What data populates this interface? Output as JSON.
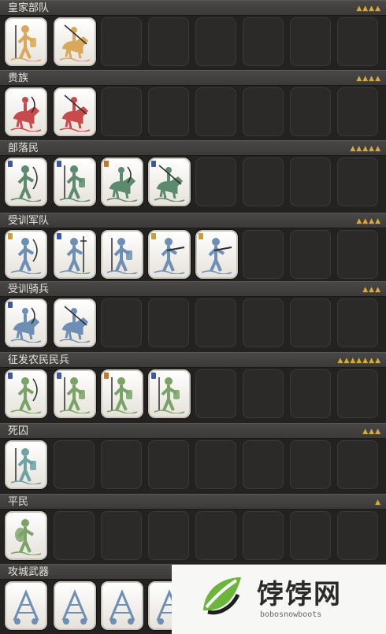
{
  "sections": [
    {
      "id": "royal",
      "title": "皇家部队",
      "pips": "▲▲▲▲",
      "units": [
        {
          "name": "royal-spear-infantry-card",
          "color": "#d9a85a",
          "tier": "",
          "kind": "foot-spear"
        },
        {
          "name": "royal-cavalry-card",
          "color": "#d9a85a",
          "tier": "",
          "kind": "horse-lance"
        }
      ]
    },
    {
      "id": "noble",
      "title": "贵族",
      "pips": "▲▲▲▲",
      "units": [
        {
          "name": "noble-horse-archer-card",
          "color": "#c94a4a",
          "tier": "",
          "kind": "horse-bow"
        },
        {
          "name": "noble-cavalry-card",
          "color": "#c94a4a",
          "tier": "",
          "kind": "horse-lance"
        }
      ]
    },
    {
      "id": "tribal",
      "title": "部落民",
      "pips": "▲▲▲▲▲",
      "units": [
        {
          "name": "tribal-archer-card",
          "color": "#5d8a6f",
          "tier": "#3a5aa0",
          "kind": "foot-bow"
        },
        {
          "name": "tribal-spearman-card",
          "color": "#5d8a6f",
          "tier": "#3a5aa0",
          "kind": "foot-spear"
        },
        {
          "name": "tribal-horse-archer-card",
          "color": "#5d8a6f",
          "tier": "#c07a2a",
          "kind": "horse-bow"
        },
        {
          "name": "tribal-cavalry-card",
          "color": "#5d8a6f",
          "tier": "#3a5aa0",
          "kind": "horse-lance"
        }
      ]
    },
    {
      "id": "trained",
      "title": "受训军队",
      "pips": "▲▲▲▲",
      "units": [
        {
          "name": "trained-archer-card",
          "color": "#6d8fb5",
          "tier": "#c9a038",
          "kind": "foot-bow"
        },
        {
          "name": "trained-pikeman-card",
          "color": "#6d8fb5",
          "tier": "#3a5aa0",
          "kind": "foot-pike"
        },
        {
          "name": "trained-swordsman-card",
          "color": "#6d8fb5",
          "tier": "",
          "kind": "foot-spear"
        },
        {
          "name": "trained-handgunner-card",
          "color": "#6d8fb5",
          "tier": "#c9a038",
          "kind": "foot-gun"
        },
        {
          "name": "trained-heavy-gunner-card",
          "color": "#6d8fb5",
          "tier": "#c9a038",
          "kind": "foot-gun"
        }
      ]
    },
    {
      "id": "trained-cav",
      "title": "受训骑兵",
      "pips": "▲▲▲",
      "units": [
        {
          "name": "trained-horse-archer-card",
          "color": "#6d8fb5",
          "tier": "#3a5aa0",
          "kind": "horse-bow"
        },
        {
          "name": "trained-cavalry-card",
          "color": "#6d8fb5",
          "tier": "",
          "kind": "horse-lance"
        }
      ]
    },
    {
      "id": "levy",
      "title": "征发农民民兵",
      "pips": "▲▲▲▲▲▲▲",
      "units": [
        {
          "name": "levy-archer-card",
          "color": "#7aa368",
          "tier": "#3a5aa0",
          "kind": "foot-bow"
        },
        {
          "name": "levy-spearman-card",
          "color": "#7aa368",
          "tier": "#3a5aa0",
          "kind": "foot-spear"
        },
        {
          "name": "levy-axeman-card",
          "color": "#7aa368",
          "tier": "#c07a2a",
          "kind": "foot-spear"
        },
        {
          "name": "levy-shield-card",
          "color": "#7aa368",
          "tier": "#3a5aa0",
          "kind": "foot-spear"
        }
      ]
    },
    {
      "id": "prisoners",
      "title": "死囚",
      "pips": "▲▲▲",
      "units": [
        {
          "name": "prisoner-card",
          "color": "#6fa3a3",
          "tier": "",
          "kind": "foot-spear"
        }
      ]
    },
    {
      "id": "civilians",
      "title": "平民",
      "pips": "▲",
      "units": [
        {
          "name": "civilian-card",
          "color": "#7aa368",
          "tier": "",
          "kind": "foot-carry"
        }
      ]
    },
    {
      "id": "siege",
      "title": "攻城武器",
      "pips": "",
      "units": [
        {
          "name": "siege-trebuchet-card",
          "color": "#6d8fb5",
          "tier": "",
          "kind": "siege"
        },
        {
          "name": "siege-catapult-card",
          "color": "#6d8fb5",
          "tier": "",
          "kind": "siege"
        },
        {
          "name": "siege-tower-card",
          "color": "#6d8fb5",
          "tier": "",
          "kind": "siege"
        },
        {
          "name": "siege-ram-card",
          "color": "#6d8fb5",
          "tier": "",
          "kind": "siege"
        }
      ]
    }
  ],
  "logo": {
    "text": "饽饽网",
    "sub": "bobosnowboots"
  }
}
